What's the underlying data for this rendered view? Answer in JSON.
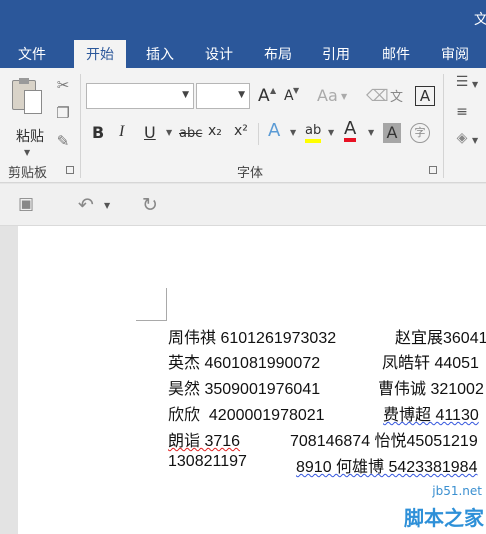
{
  "window": {
    "title": "文"
  },
  "tabs": [
    {
      "label": "文件"
    },
    {
      "label": "开始"
    },
    {
      "label": "插入"
    },
    {
      "label": "设计"
    },
    {
      "label": "布局"
    },
    {
      "label": "引用"
    },
    {
      "label": "邮件"
    },
    {
      "label": "审阅"
    }
  ],
  "active_tab": "开始",
  "ribbon": {
    "clipboard": {
      "paste_label": "粘贴",
      "group_label": "剪贴板"
    },
    "font": {
      "group_label": "字体",
      "font_name_value": "",
      "font_size_value": "",
      "bold": "B",
      "italic": "I",
      "underline": "U",
      "strikethrough": "abc",
      "subscript": "x₂",
      "superscript": "x²",
      "grow": "A",
      "shrink": "A",
      "change_case": "Aa",
      "phonetic": "文",
      "border_char": "A",
      "effects": "A",
      "highlight": "ab",
      "font_color": "A",
      "shading": "A",
      "enclose": "字"
    },
    "colors": {
      "accent": "#2b579a",
      "highlight": "#ffff00",
      "font_color": "#e81123"
    }
  },
  "document": {
    "lines": [
      {
        "a": "周伟祺 6101261973032",
        "b": "赵宜展36041"
      },
      {
        "a": "英杰 4601081990072",
        "b": "凤皓轩 44051"
      },
      {
        "a": "昊然 3509001976041",
        "b": "曹伟诚 321002"
      },
      {
        "a": "欣欣  4200001978021",
        "b": "费博超 41130"
      },
      {
        "a": "朗诣 3716",
        "b": "708146874 怡悦45051219"
      },
      {
        "a": "130821197",
        "b": "8910 何雄博 5423381984"
      }
    ]
  },
  "watermark": {
    "site": "jb51.net",
    "name": "脚本之家"
  }
}
